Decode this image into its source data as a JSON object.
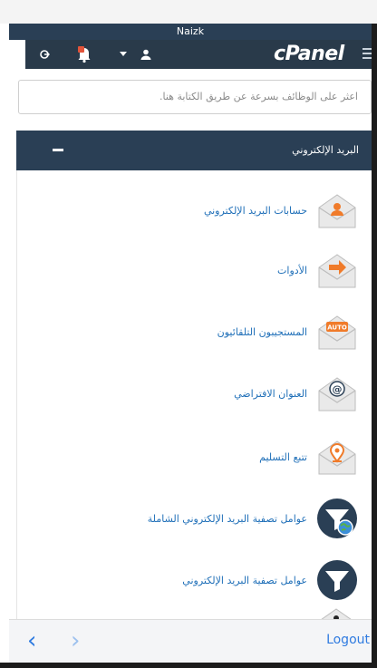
{
  "window": {
    "title": "Naizk"
  },
  "header": {
    "brand": "cPanel"
  },
  "search": {
    "placeholder": "اعثر على الوظائف بسرعة عن طريق الكتابة هنا."
  },
  "group": {
    "title": "البريد الإلكتروني"
  },
  "items": [
    {
      "label": "حسابات البريد الإلكتروني",
      "icon": "envelope-user-icon"
    },
    {
      "label": "الأدوات",
      "icon": "envelope-forward-icon"
    },
    {
      "label": "المستجيبون التلقائيون",
      "icon": "envelope-auto-icon",
      "badge": "AUTO"
    },
    {
      "label": "العنوان الافتراضي",
      "icon": "envelope-at-icon",
      "badge": "@"
    },
    {
      "label": "تتبع التسليم",
      "icon": "envelope-location-icon"
    },
    {
      "label": "عوامل تصفية البريد الإلكتروني الشاملة",
      "icon": "global-filter-icon"
    },
    {
      "label": "عوامل تصفية البريد الإلكتروني",
      "icon": "filter-icon"
    }
  ],
  "bottom": {
    "logout": "Logout"
  },
  "colors": {
    "navy": "#2a3f55",
    "orange": "#f07b2a",
    "link": "#1f6fb8",
    "ios_blue": "#2f7be0"
  }
}
